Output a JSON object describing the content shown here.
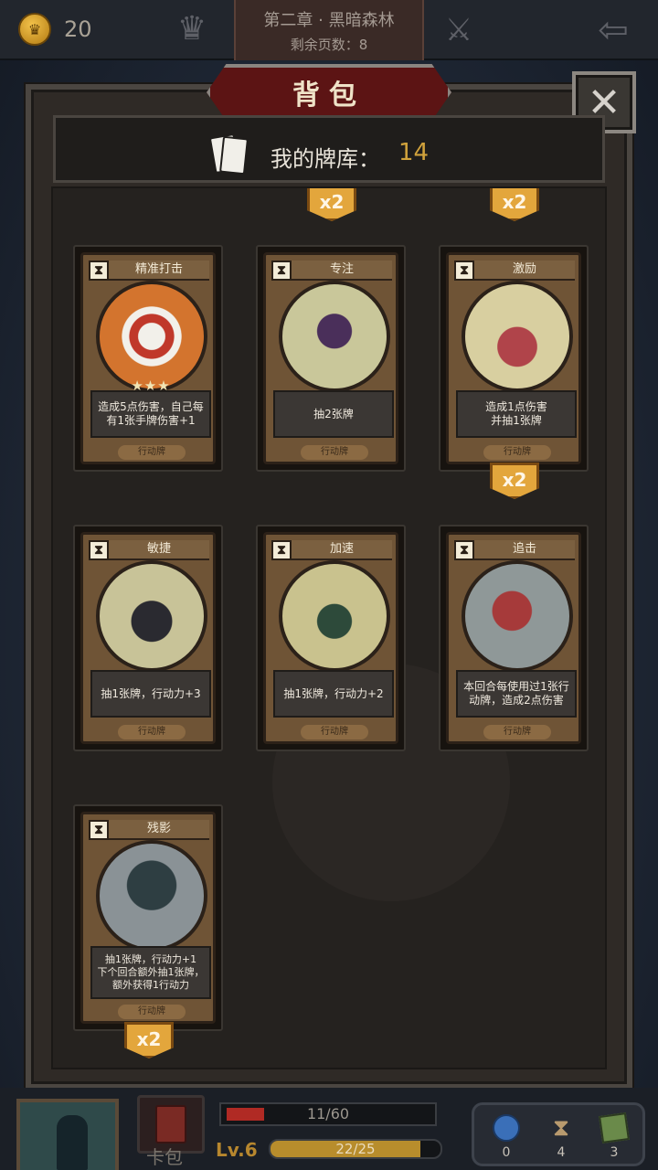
{
  "topbar": {
    "coin_count": "20",
    "chapter_title": "第二章 · 黑暗森林",
    "pages_remaining": "剩余页数：8"
  },
  "modal": {
    "title": "背包",
    "close_icon": "close-icon",
    "deck_label": "我的牌库：",
    "deck_count": "14"
  },
  "partial_badges": [
    "x2",
    "x2"
  ],
  "cards": [
    {
      "name": "精准打击",
      "desc": "造成5点伤害，自己每有1张手牌伤害+1",
      "type": "行动牌",
      "stars": "★★★",
      "count": "",
      "art_color": "#c24a2a"
    },
    {
      "name": "专注",
      "desc": "抽2张牌",
      "type": "行动牌",
      "stars": "",
      "count": "",
      "art_color": "#8a8a4a"
    },
    {
      "name": "激励",
      "desc": "造成1点伤害\n并抽1张牌",
      "type": "行动牌",
      "stars": "",
      "count": "x2",
      "art_color": "#a04a4a"
    },
    {
      "name": "敏捷",
      "desc": "抽1张牌，行动力+3",
      "type": "行动牌",
      "stars": "",
      "count": "",
      "art_color": "#6a6a4a"
    },
    {
      "name": "加速",
      "desc": "抽1张牌，行动力+2",
      "type": "行动牌",
      "stars": "",
      "count": "",
      "art_color": "#7a7a48"
    },
    {
      "name": "追击",
      "desc": "本回合每使用过1张行动牌，造成2点伤害",
      "type": "行动牌",
      "stars": "",
      "count": "",
      "art_color": "#8a6a6a"
    },
    {
      "name": "残影",
      "desc": "抽1张牌，行动力+1\n下个回合额外抽1张牌，\n额外获得1行动力",
      "type": "行动牌",
      "stars": "",
      "count": "x2",
      "art_color": "#4a5a5a"
    }
  ],
  "hud": {
    "hp": "11/60",
    "hp_fraction": 0.18,
    "level": "Lv.6",
    "xp": "22/25",
    "xp_fraction": 0.88,
    "card_bag_label": "卡包",
    "res_potion": "0",
    "res_hourglass": "4",
    "res_cards": "3"
  },
  "colors": {
    "gold": "#d0a23c",
    "title_red": "#5c1414",
    "badge_orange": "#e3a63c"
  }
}
